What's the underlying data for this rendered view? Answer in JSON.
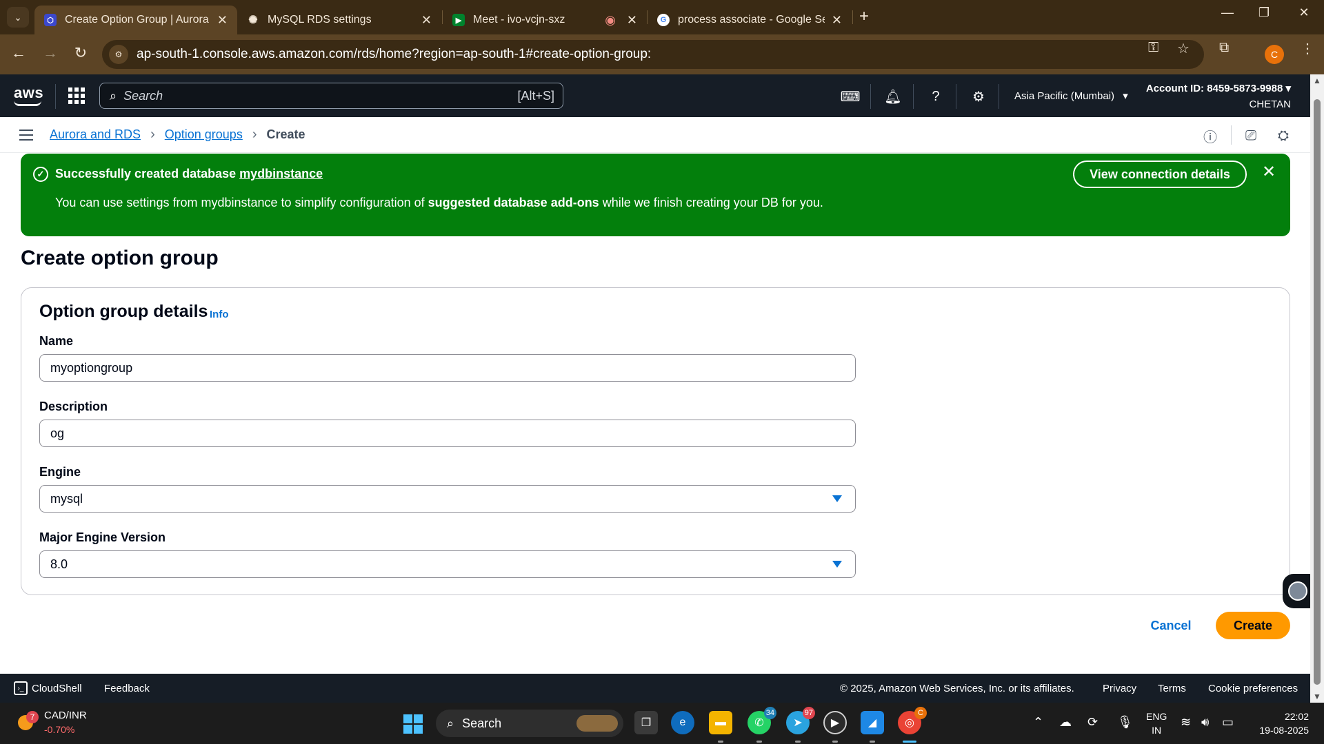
{
  "browser": {
    "tabs": [
      {
        "title": "Create Option Group | Aurora a",
        "active": true,
        "favicon": "aws-rds-favicon"
      },
      {
        "title": "MySQL RDS settings",
        "active": false,
        "favicon": "chatgpt-favicon"
      },
      {
        "title": "Meet - ivo-vcjn-sxz",
        "active": false,
        "favicon": "google-meet-favicon"
      },
      {
        "title": "process associate - Google Sear",
        "active": false,
        "favicon": "google-favicon"
      }
    ],
    "url": "ap-south-1.console.aws.amazon.com/rds/home?region=ap-south-1#create-option-group:",
    "profile_initial": "C"
  },
  "aws_header": {
    "logo": "aws",
    "search_placeholder": "Search",
    "search_shortcut": "[Alt+S]",
    "region": "Asia Pacific (Mumbai)",
    "account_id": "Account ID: 8459-5873-9988",
    "user": "CHETAN"
  },
  "breadcrumb": {
    "items": [
      "Aurora and RDS",
      "Option groups"
    ],
    "current": "Create"
  },
  "flash": {
    "title_prefix": "Successfully created database",
    "db_name": "mydbinstance",
    "body_part1": "You can use settings from mydbinstance to simplify configuration of",
    "body_bold": "suggested database add-ons",
    "body_part2": "while we finish creating your DB for you.",
    "action_label": "View connection details",
    "color": "#037f0c"
  },
  "page": {
    "title": "Create option group",
    "section_title": "Option group details",
    "info_label": "Info",
    "fields": {
      "name": {
        "label": "Name",
        "value": "myoptiongroup"
      },
      "description": {
        "label": "Description",
        "value": "og"
      },
      "engine": {
        "label": "Engine",
        "value": "mysql"
      },
      "major_version": {
        "label": "Major Engine Version",
        "value": "8.0"
      }
    },
    "cancel_label": "Cancel",
    "create_label": "Create",
    "primary_color": "#ff9900"
  },
  "aws_footer": {
    "cloudshell": "CloudShell",
    "feedback": "Feedback",
    "copyright": "© 2025, Amazon Web Services, Inc. or its affiliates.",
    "privacy": "Privacy",
    "terms": "Terms",
    "cookie": "Cookie preferences"
  },
  "taskbar": {
    "widget_badge": "7",
    "widget_title": "CAD/INR",
    "widget_change": "-0.70%",
    "search_placeholder": "Search",
    "whatsapp_badge": "34",
    "telegram_badge": "97",
    "chrome_badge": "C",
    "lang_line1": "ENG",
    "lang_line2": "IN",
    "time": "22:02",
    "date": "19-08-2025"
  }
}
